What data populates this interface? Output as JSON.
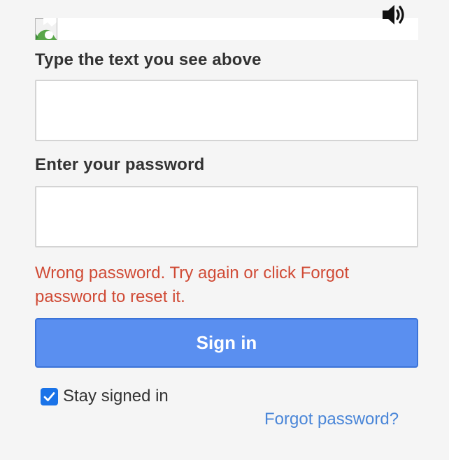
{
  "captcha": {
    "label": "Type the text you see above",
    "input_value": "",
    "image_icon": "broken-image-icon",
    "audio_icon": "speaker-icon"
  },
  "password": {
    "label": "Enter your password",
    "input_value": ""
  },
  "error": {
    "message": "Wrong password. Try again or click Forgot password to reset it."
  },
  "actions": {
    "sign_in_label": "Sign in",
    "stay_signed_in_label": "Stay signed in",
    "stay_signed_in_checked": true,
    "forgot_password_label": "Forgot password?"
  },
  "colors": {
    "error": "#d04a35",
    "primary_button": "#5a8ff0",
    "link": "#4a86d8",
    "checkbox": "#1a73e8"
  }
}
